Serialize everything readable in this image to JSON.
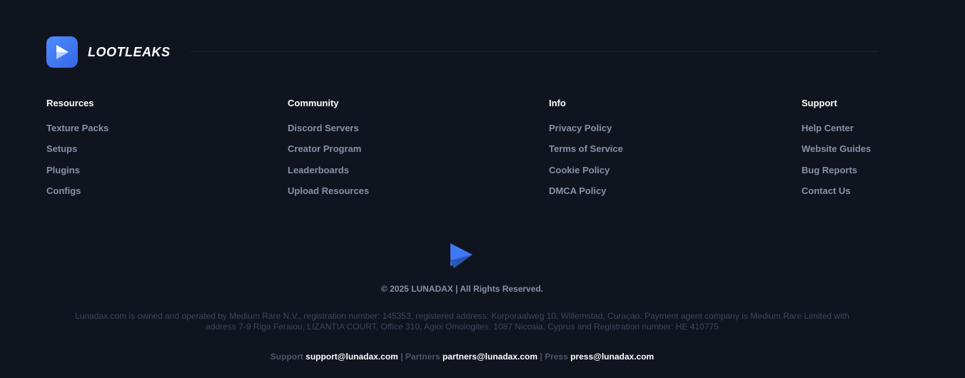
{
  "brand": {
    "name": "LOOTLEAKS",
    "accent": "#4d8dff"
  },
  "columns": [
    {
      "title": "Resources",
      "links": [
        "Texture Packs",
        "Setups",
        "Plugins",
        "Configs"
      ]
    },
    {
      "title": "Community",
      "links": [
        "Discord Servers",
        "Creator Program",
        "Leaderboards",
        "Upload Resources"
      ]
    },
    {
      "title": "Info",
      "links": [
        "Privacy Policy",
        "Terms of Service",
        "Cookie Policy",
        "DMCA Policy"
      ]
    },
    {
      "title": "Support",
      "links": [
        "Help Center",
        "Website Guides",
        "Bug Reports",
        "Contact Us"
      ]
    }
  ],
  "copyright": "© 2025 LUNADAX | All Rights Reserved.",
  "legal": {
    "line1": "Lunadax.com is owned and operated by Medium Rare N.V., registration number: 145353, registered address: Korporaalweg 10, Willemstad, Curaçao. Payment agent company is Medium Rare Limited with",
    "line2": "address 7-9 Riga Feraiou, LIZANTIA COURT, Office 310, Agioi Omologites, 1087 Nicosia, Cyprus and Registration number: HE 410775"
  },
  "contacts": {
    "support_label": "Support",
    "support_email": "support@lunadax.com",
    "partners_label": "Partners",
    "partners_email": "partners@lunadax.com",
    "press_label": "Press",
    "press_email": "press@lunadax.com",
    "separator": "|"
  }
}
